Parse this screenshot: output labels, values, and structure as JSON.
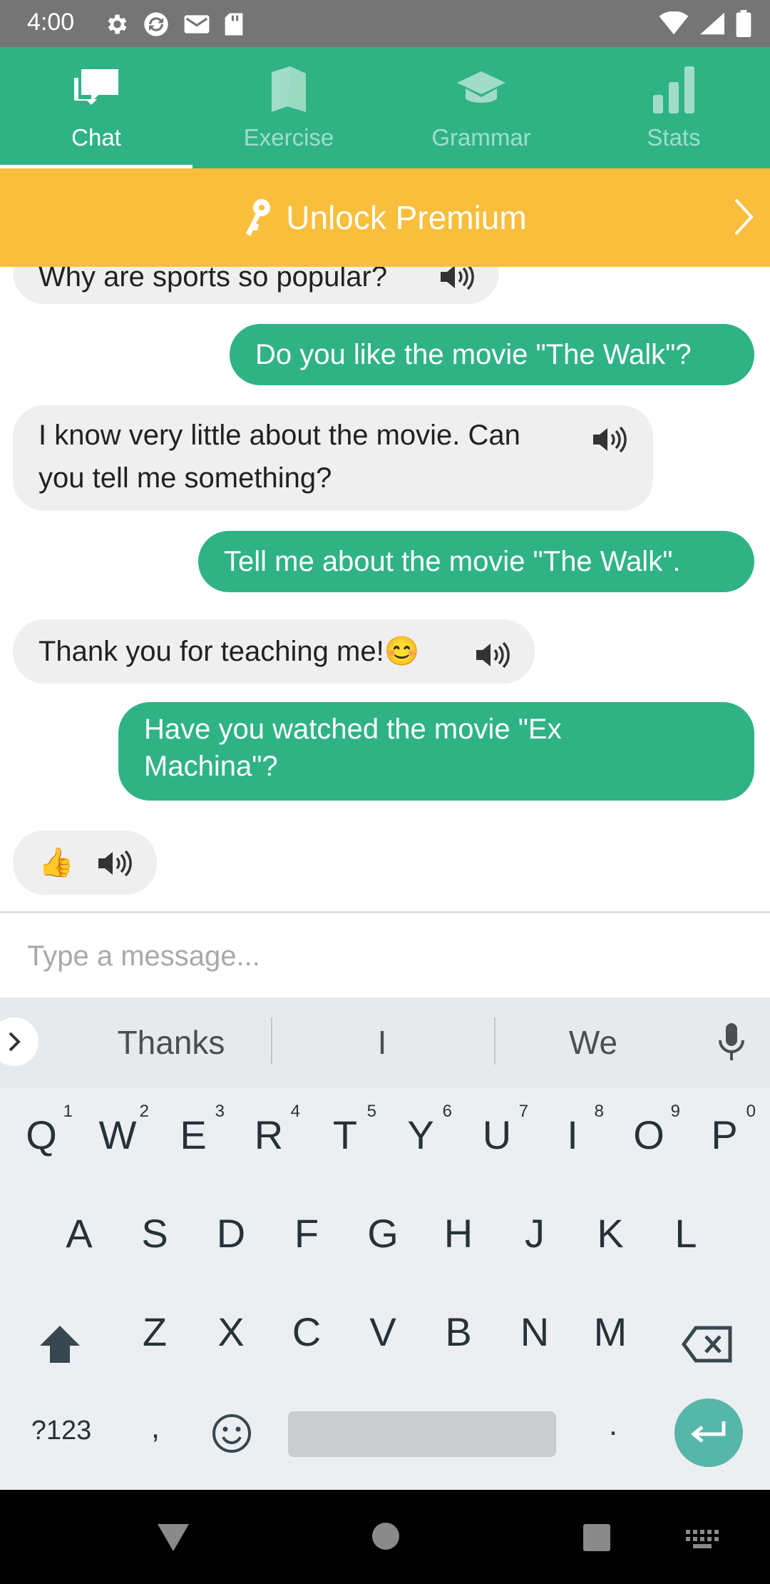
{
  "status": {
    "time": "4:00"
  },
  "tabs": [
    {
      "label": "Chat",
      "icon": "chat-icon",
      "active": true
    },
    {
      "label": "Exercise",
      "icon": "book-icon",
      "active": false
    },
    {
      "label": "Grammar",
      "icon": "graduation-cap-icon",
      "active": false
    },
    {
      "label": "Stats",
      "icon": "bar-chart-icon",
      "active": false
    }
  ],
  "premium": {
    "label": "Unlock Premium",
    "icon": "key-icon"
  },
  "messages": [
    {
      "from": "bot",
      "text": "Why are sports so popular?"
    },
    {
      "from": "user",
      "text": "Do you like the movie \"The Walk\"?"
    },
    {
      "from": "bot",
      "line1": "I know very little about the movie. Can",
      "line2": "you tell me something?"
    },
    {
      "from": "user",
      "text": "Tell me about the movie \"The Walk\"."
    },
    {
      "from": "bot",
      "text": "Thank you for teaching me!😊"
    },
    {
      "from": "user",
      "line1": "Have you watched the movie \"Ex",
      "line2": "Machina\"?"
    },
    {
      "from": "bot",
      "text": "👍"
    }
  ],
  "input": {
    "placeholder": "Type a message..."
  },
  "keyboard": {
    "suggestions": [
      "Thanks",
      "I",
      "We"
    ],
    "row1": [
      "Q",
      "W",
      "E",
      "R",
      "T",
      "Y",
      "U",
      "I",
      "O",
      "P"
    ],
    "row1_hints": [
      "1",
      "2",
      "3",
      "4",
      "5",
      "6",
      "7",
      "8",
      "9",
      "0"
    ],
    "row2": [
      "A",
      "S",
      "D",
      "F",
      "G",
      "H",
      "J",
      "K",
      "L"
    ],
    "row3": [
      "Z",
      "X",
      "C",
      "V",
      "B",
      "N",
      "M"
    ],
    "symbols_key": "?123",
    "comma_key": ",",
    "period_key": "."
  },
  "colors": {
    "accent": "#2fb385",
    "premium": "#f9be3b",
    "bubble_bot": "#efefef"
  }
}
